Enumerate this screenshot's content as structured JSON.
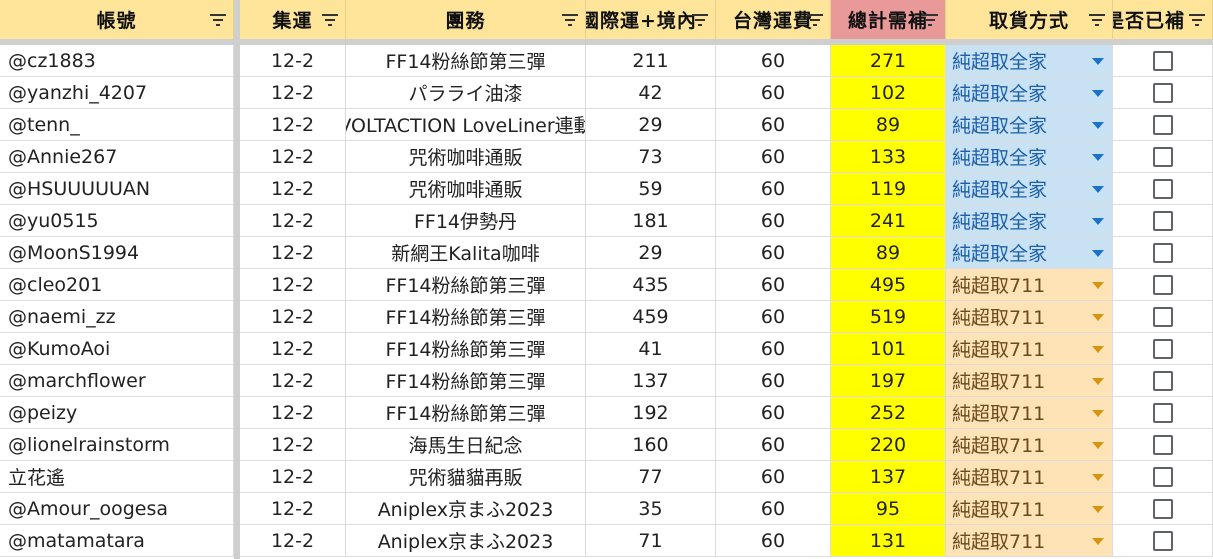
{
  "columns": [
    {
      "label": "帳號"
    },
    {
      "label": "集運"
    },
    {
      "label": "團務"
    },
    {
      "label": "國際運+境內"
    },
    {
      "label": "台灣運費"
    },
    {
      "label": "總計需補"
    },
    {
      "label": "取貨方式"
    },
    {
      "label": "是否已補"
    }
  ],
  "colors": {
    "header_bg": "#ffe599",
    "header_highlight_bg": "#ea9999",
    "total_bg": "#ffff00",
    "family_mart_bg": "#c9e2f3",
    "seven_eleven_bg": "#fde3b6"
  },
  "rows": [
    {
      "account": "@cz1883",
      "shipment": "12-2",
      "group": "FF14粉絲節第三彈",
      "intl": "211",
      "tw": "60",
      "total": "271",
      "pickup": "純超取全家",
      "pickup_type": "family",
      "paid": false
    },
    {
      "account": "@yanzhi_4207",
      "shipment": "12-2",
      "group": "パラライ油漆",
      "intl": "42",
      "tw": "60",
      "total": "102",
      "pickup": "純超取全家",
      "pickup_type": "family",
      "paid": false
    },
    {
      "account": "@tenn_",
      "shipment": "12-2",
      "group": "VOLTACTION LoveLiner連動",
      "intl": "29",
      "tw": "60",
      "total": "89",
      "pickup": "純超取全家",
      "pickup_type": "family",
      "paid": false
    },
    {
      "account": "@Annie267",
      "shipment": "12-2",
      "group": "咒術咖啡通販",
      "intl": "73",
      "tw": "60",
      "total": "133",
      "pickup": "純超取全家",
      "pickup_type": "family",
      "paid": false
    },
    {
      "account": "@HSUUUUUAN",
      "shipment": "12-2",
      "group": "咒術咖啡通販",
      "intl": "59",
      "tw": "60",
      "total": "119",
      "pickup": "純超取全家",
      "pickup_type": "family",
      "paid": false
    },
    {
      "account": "@yu0515",
      "shipment": "12-2",
      "group": "FF14伊勢丹",
      "intl": "181",
      "tw": "60",
      "total": "241",
      "pickup": "純超取全家",
      "pickup_type": "family",
      "paid": false
    },
    {
      "account": "@MoonS1994",
      "shipment": "12-2",
      "group": "新網王Kalita咖啡",
      "intl": "29",
      "tw": "60",
      "total": "89",
      "pickup": "純超取全家",
      "pickup_type": "family",
      "paid": false
    },
    {
      "account": "@cleo201",
      "shipment": "12-2",
      "group": "FF14粉絲節第三彈",
      "intl": "435",
      "tw": "60",
      "total": "495",
      "pickup": "純超取711",
      "pickup_type": "seven",
      "paid": false
    },
    {
      "account": "@naemi_zz",
      "shipment": "12-2",
      "group": "FF14粉絲節第三彈",
      "intl": "459",
      "tw": "60",
      "total": "519",
      "pickup": "純超取711",
      "pickup_type": "seven",
      "paid": false
    },
    {
      "account": "@KumoAoi",
      "shipment": "12-2",
      "group": "FF14粉絲節第三彈",
      "intl": "41",
      "tw": "60",
      "total": "101",
      "pickup": "純超取711",
      "pickup_type": "seven",
      "paid": false
    },
    {
      "account": "@marchflower",
      "shipment": "12-2",
      "group": "FF14粉絲節第三彈",
      "intl": "137",
      "tw": "60",
      "total": "197",
      "pickup": "純超取711",
      "pickup_type": "seven",
      "paid": false
    },
    {
      "account": "@peizy",
      "shipment": "12-2",
      "group": "FF14粉絲節第三彈",
      "intl": "192",
      "tw": "60",
      "total": "252",
      "pickup": "純超取711",
      "pickup_type": "seven",
      "paid": false
    },
    {
      "account": "@lionelrainstorm",
      "shipment": "12-2",
      "group": "海馬生日紀念",
      "intl": "160",
      "tw": "60",
      "total": "220",
      "pickup": "純超取711",
      "pickup_type": "seven",
      "paid": false
    },
    {
      "account": "立花遙",
      "shipment": "12-2",
      "group": "咒術貓貓再販",
      "intl": "77",
      "tw": "60",
      "total": "137",
      "pickup": "純超取711",
      "pickup_type": "seven",
      "paid": false
    },
    {
      "account": "@Amour_oogesa",
      "shipment": "12-2",
      "group": "Aniplex京まふ2023",
      "intl": "35",
      "tw": "60",
      "total": "95",
      "pickup": "純超取711",
      "pickup_type": "seven",
      "paid": false
    },
    {
      "account": "@matamatara",
      "shipment": "12-2",
      "group": "Aniplex京まふ2023",
      "intl": "71",
      "tw": "60",
      "total": "131",
      "pickup": "純超取711",
      "pickup_type": "seven",
      "paid": false
    }
  ]
}
